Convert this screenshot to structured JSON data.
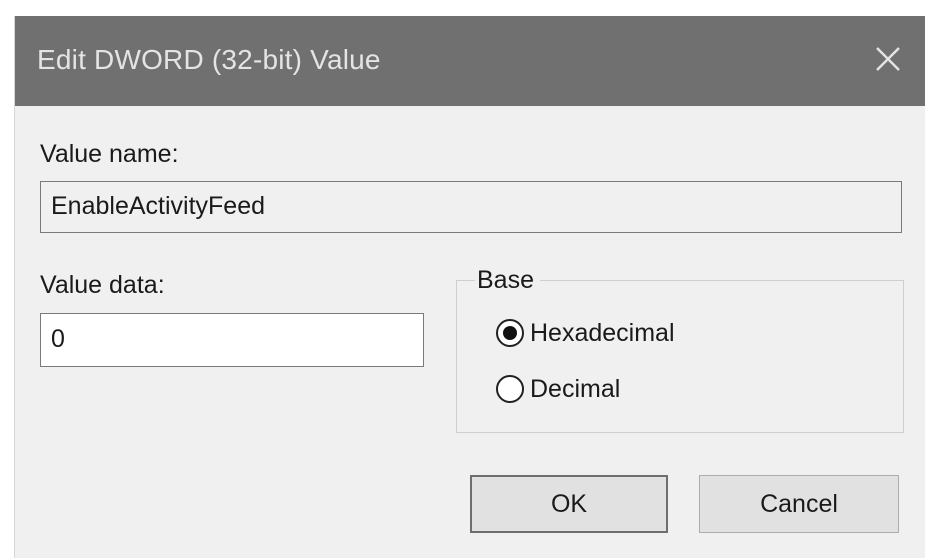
{
  "dialog": {
    "title": "Edit DWORD (32-bit) Value",
    "close_icon": "close-icon"
  },
  "value_name": {
    "label": "Value name:",
    "value": "EnableActivityFeed"
  },
  "value_data": {
    "label": "Value data:",
    "value": "0"
  },
  "base": {
    "legend": "Base",
    "options": [
      {
        "label": "Hexadecimal",
        "selected": true
      },
      {
        "label": "Decimal",
        "selected": false
      }
    ]
  },
  "buttons": {
    "ok_label": "OK",
    "cancel_label": "Cancel"
  },
  "colors": {
    "titlebar": "#707070",
    "dialog_background": "#f0f0f0"
  }
}
